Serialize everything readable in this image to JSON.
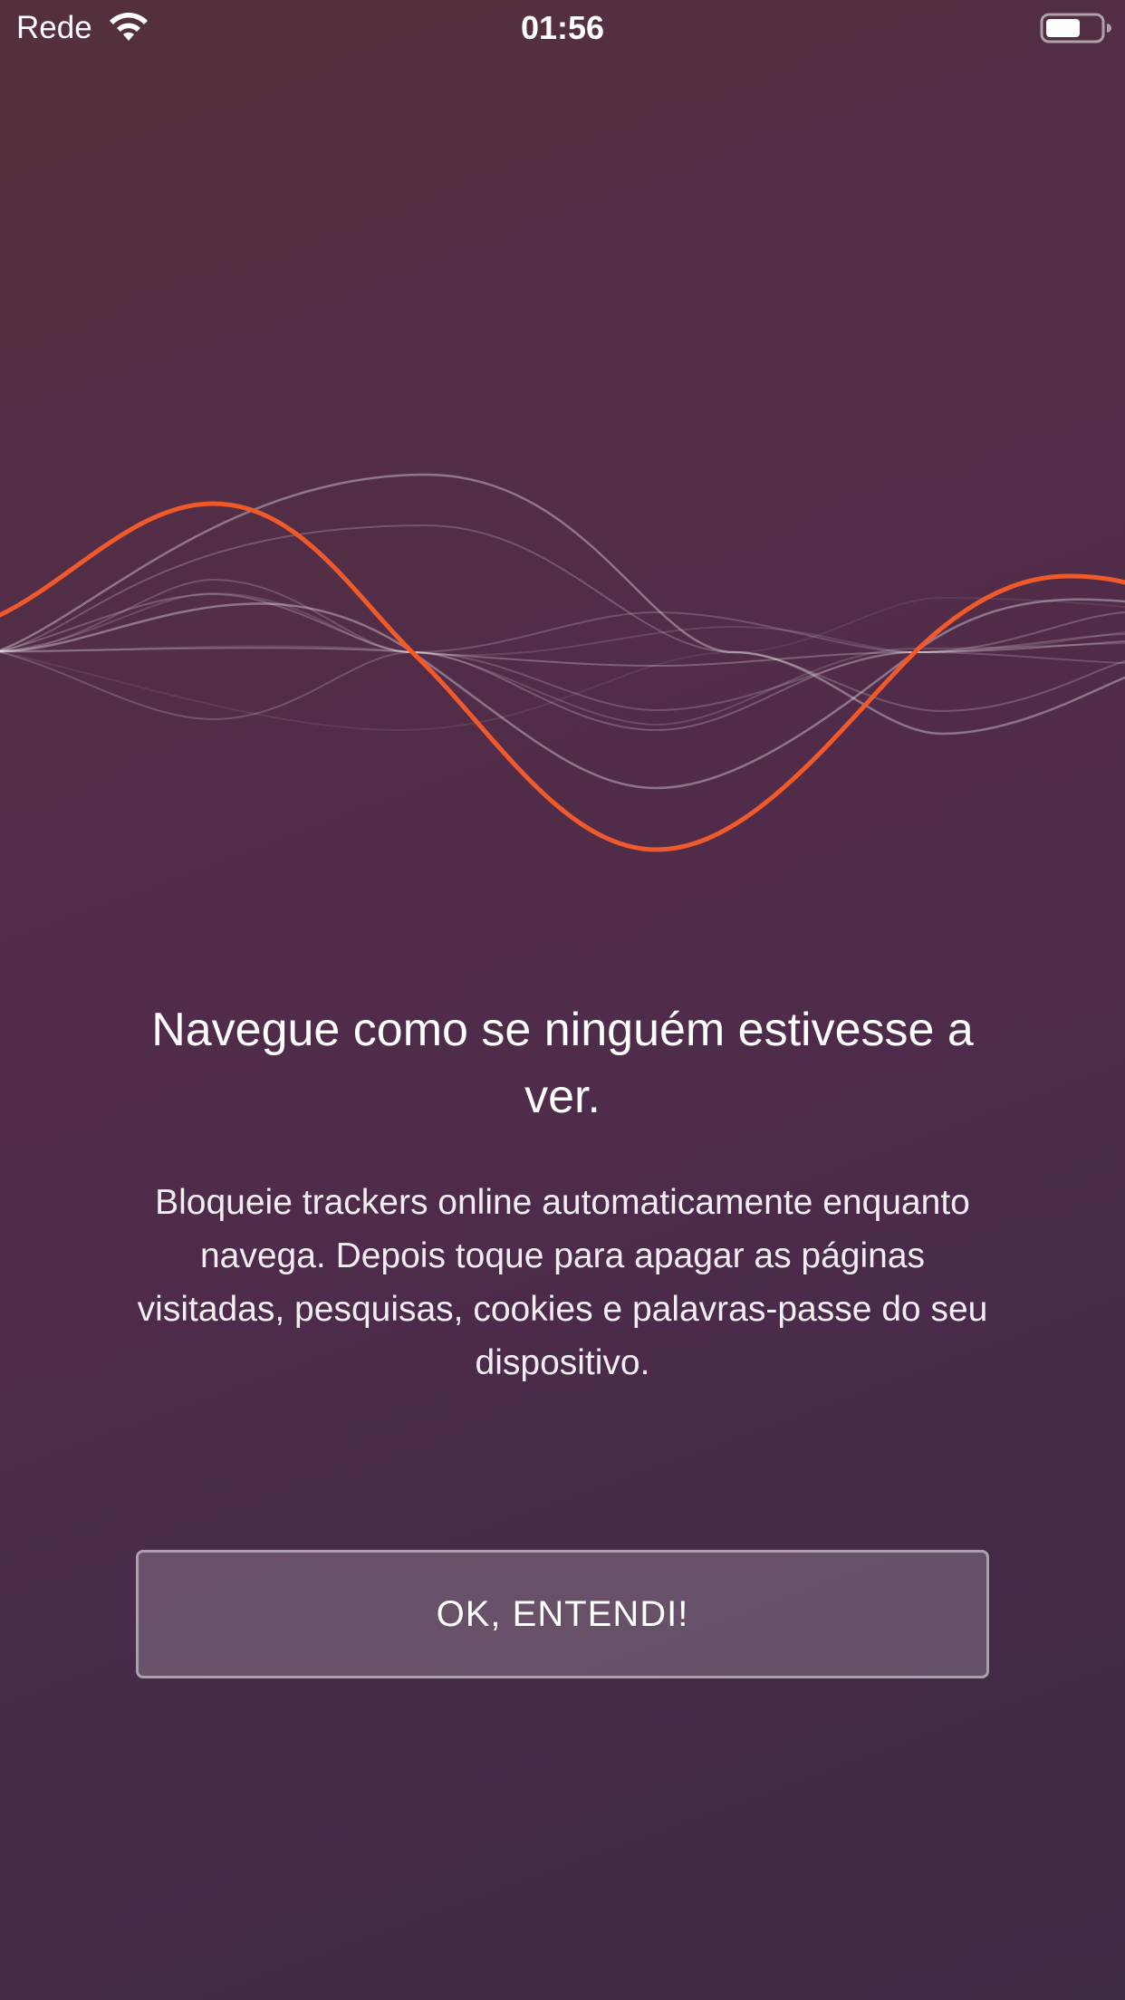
{
  "status_bar": {
    "carrier": "Rede",
    "time": "01:56",
    "wifi_icon": "wifi-icon",
    "battery_icon": "battery-icon",
    "battery_level": 0.6
  },
  "onboarding": {
    "illustration": "sound-wave-illustration",
    "headline": "Navegue como se ninguém estivesse a ver.",
    "description": "Bloqueie trackers online automaticamente enquanto navega. Depois toque para apagar as páginas visitadas, pesquisas, cookies e palavras-passe do seu dispositivo.",
    "ok_button_label": "OK, ENTENDI!"
  },
  "colors": {
    "accent_orange": "#f05a2b",
    "background_top": "#54303e",
    "background_bottom": "#3d2a45"
  }
}
